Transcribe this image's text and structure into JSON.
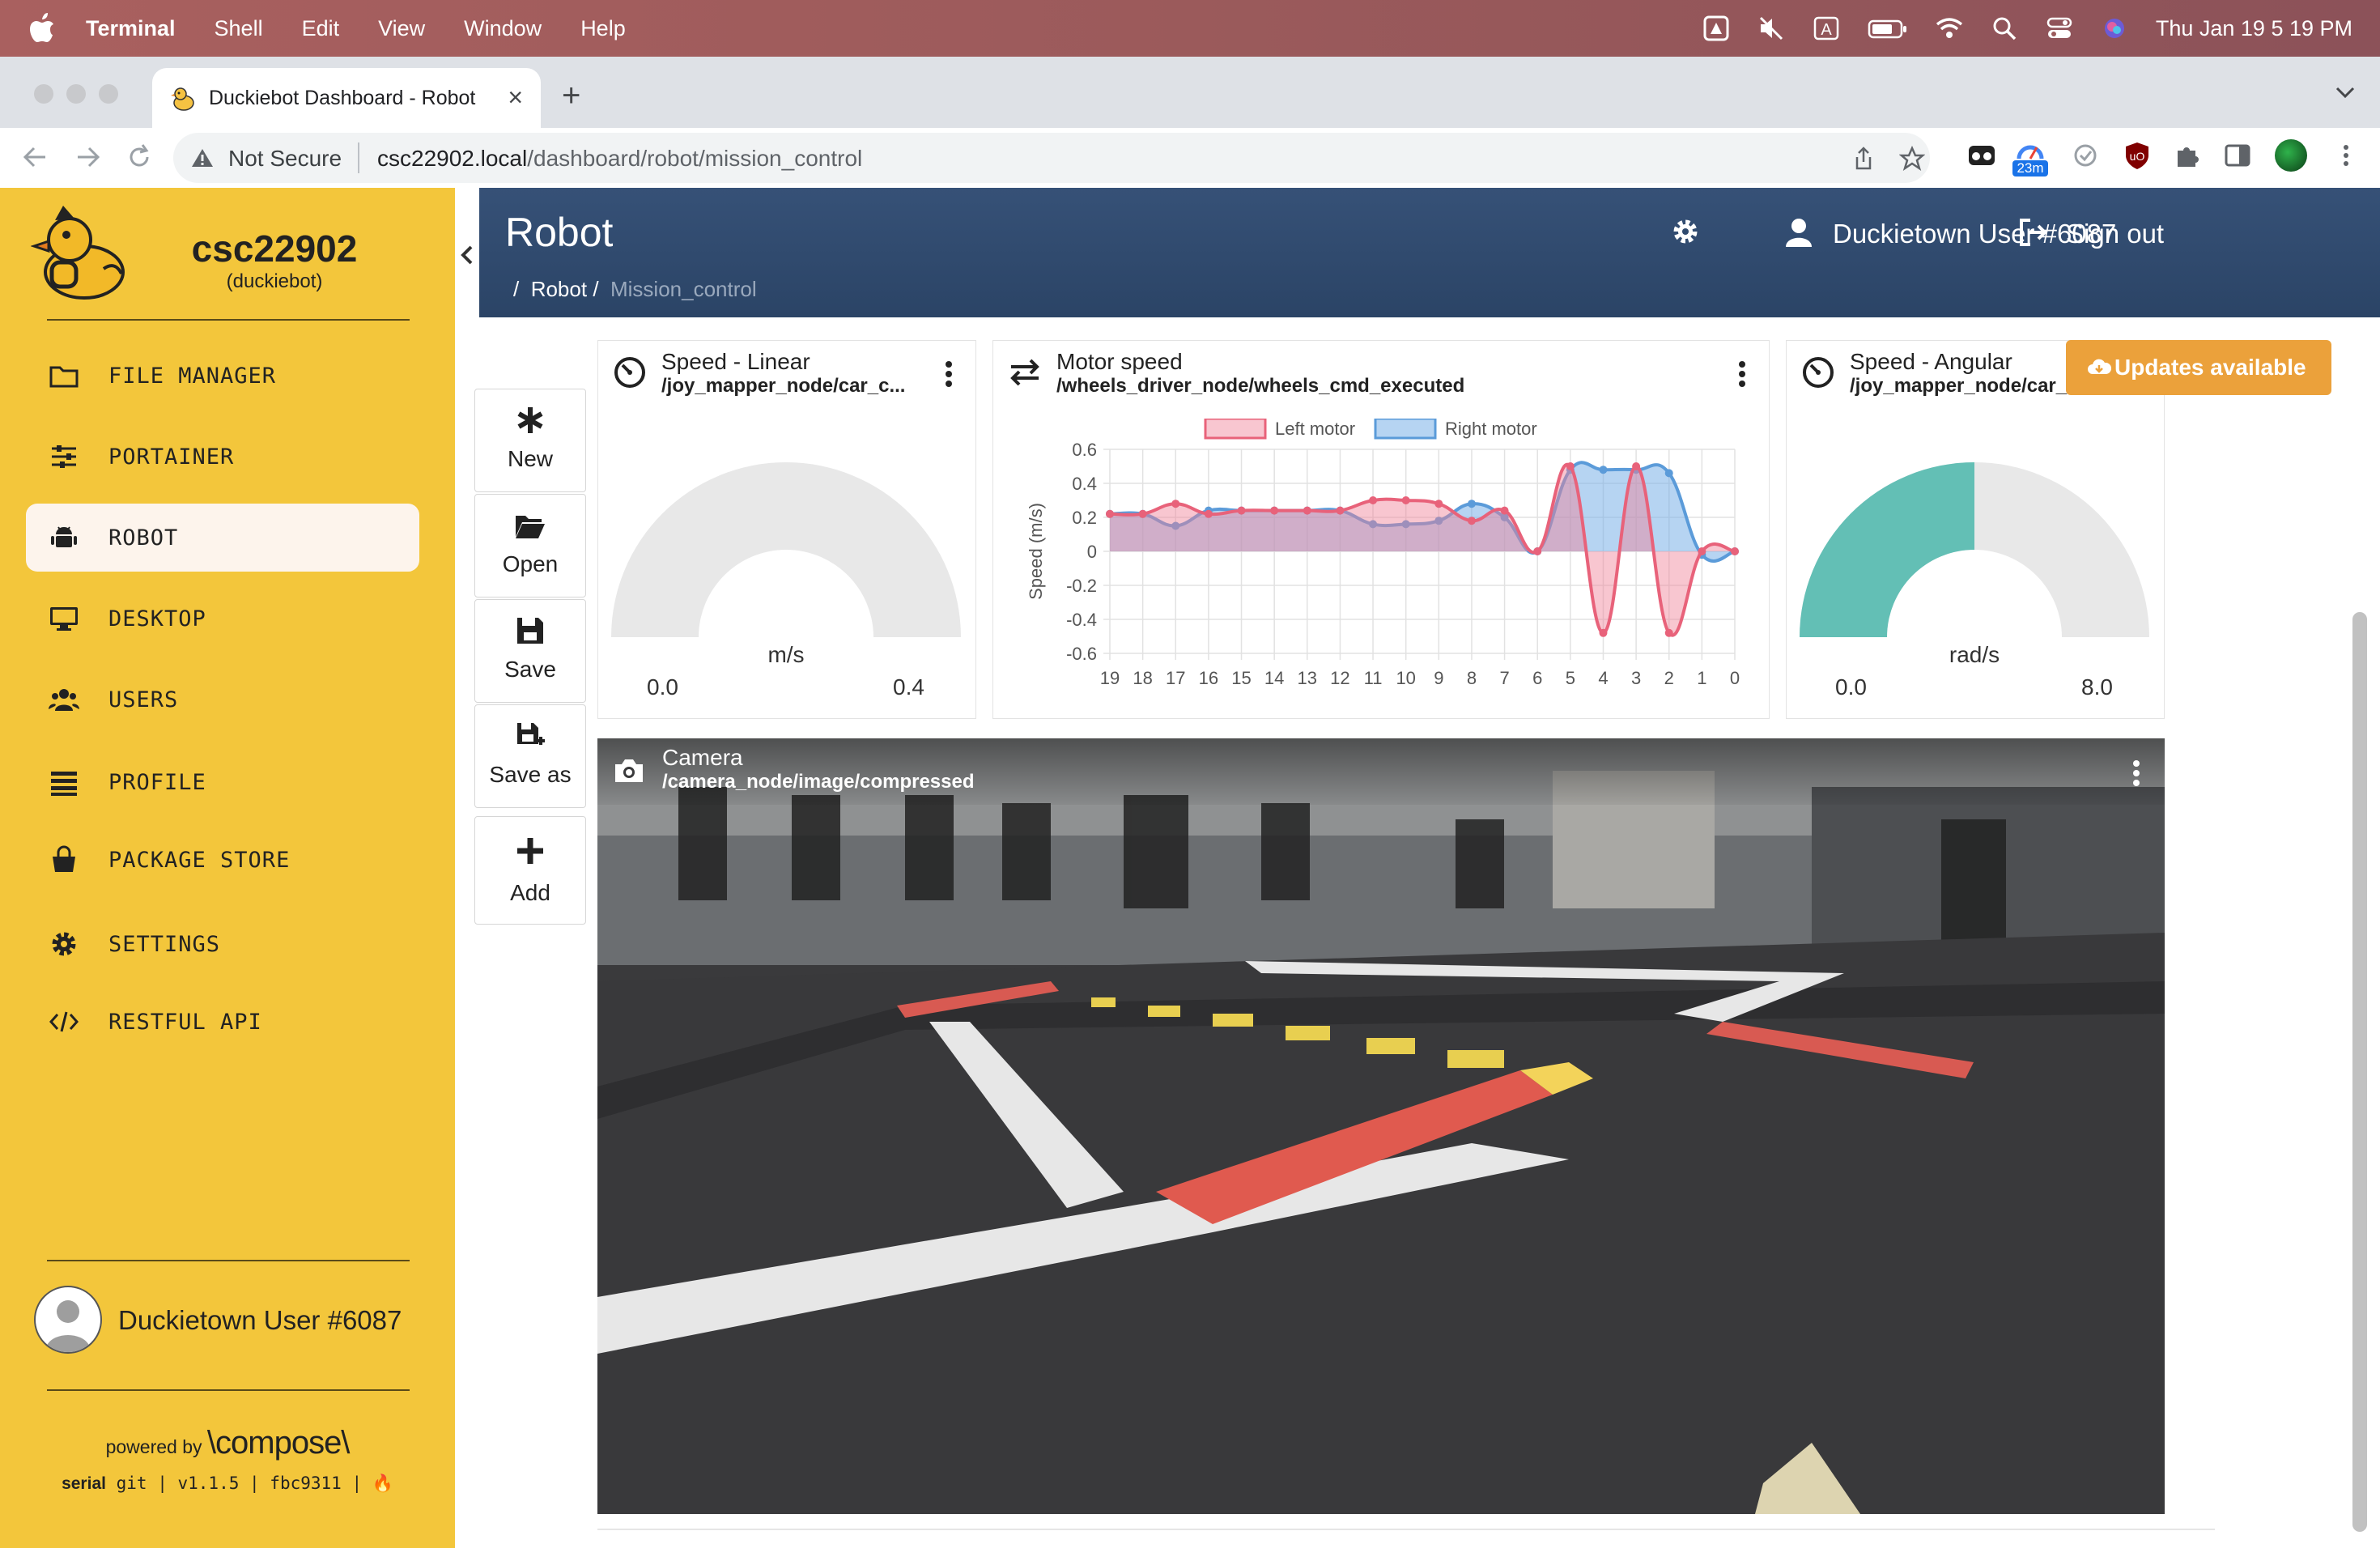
{
  "menubar": {
    "app": "Terminal",
    "items": [
      "Shell",
      "Edit",
      "View",
      "Window",
      "Help"
    ],
    "clock": "Thu Jan 19  5 19 PM"
  },
  "browser": {
    "tab_title": "Duckiebot Dashboard - Robot",
    "security": "Not Secure",
    "url_host": "csc22902.local",
    "url_path": "/dashboard/robot/mission_control",
    "ext_badge": "23m"
  },
  "sidebar": {
    "hostname": "csc22902",
    "robot_type": "(duckiebot)",
    "items": [
      {
        "label": "FILE MANAGER",
        "icon": "folder-icon"
      },
      {
        "label": "PORTAINER",
        "icon": "sliders-icon"
      },
      {
        "label": "ROBOT",
        "icon": "android-icon",
        "active": true
      },
      {
        "label": "DESKTOP",
        "icon": "monitor-icon"
      },
      {
        "label": "USERS",
        "icon": "users-icon"
      },
      {
        "label": "PROFILE",
        "icon": "list-icon"
      },
      {
        "label": "PACKAGE STORE",
        "icon": "shopping-bag-icon"
      },
      {
        "label": "SETTINGS",
        "icon": "gear-icon"
      },
      {
        "label": "RESTFUL API",
        "icon": "code-icon"
      }
    ],
    "user_name": "Duckietown User #6087",
    "powered_by": "powered by",
    "brand": "\\compose\\",
    "footer_serial": "serial",
    "footer_git": "git",
    "footer_version": "v1.1.5",
    "footer_hash": "fbc9311"
  },
  "header": {
    "title": "Robot",
    "breadcrumb_sep": "/",
    "breadcrumb_robot": "Robot",
    "breadcrumb_current": "Mission_control",
    "user_name": "Duckietown User #6087",
    "signout": "Sign out"
  },
  "toolbar": {
    "new": "New",
    "open": "Open",
    "save": "Save",
    "save_as": "Save as",
    "add": "Add"
  },
  "updates_label": "Updates available",
  "widgets": {
    "speed_linear": {
      "title": "Speed - Linear",
      "topic": "/joy_mapper_node/car_c...",
      "unit": "m/s",
      "min": "0.0",
      "max": "0.4",
      "value_fraction": 0
    },
    "motor_speed": {
      "title": "Motor speed",
      "topic": "/wheels_driver_node/wheels_cmd_executed"
    },
    "speed_angular": {
      "title": "Speed - Angular",
      "topic": "/joy_mapper_node/car_c...",
      "unit": "rad/s",
      "min": "0.0",
      "max": "8.0",
      "value_fraction": 0.5,
      "fill_color": "#63bfb5"
    },
    "camera": {
      "title": "Camera",
      "topic": "/camera_node/image/compressed"
    }
  },
  "chart_data": {
    "type": "area",
    "x": [
      19,
      18,
      17,
      16,
      15,
      14,
      13,
      12,
      11,
      10,
      9,
      8,
      7,
      6,
      5,
      4,
      3,
      2,
      1,
      0
    ],
    "xlabel": "",
    "ylabel": "Speed (m/s)",
    "ylim": [
      -0.6,
      0.6
    ],
    "yticks": [
      0.6,
      0.4,
      0.2,
      0,
      -0.2,
      -0.4,
      -0.6
    ],
    "yticklabels": [
      "0.6",
      "0.4",
      "0.2",
      "0",
      "-0.2",
      "-0.4",
      "-0.6"
    ],
    "xticklabels": [
      "19",
      "18",
      "17",
      "16",
      "15",
      "14",
      "13",
      "12",
      "11",
      "10",
      "9",
      "8",
      "7",
      "6",
      "5",
      "4",
      "3",
      "2",
      "1",
      "0"
    ],
    "grid": true,
    "legend": "top",
    "series": [
      {
        "name": "Left motor",
        "color": "#e8627a",
        "fill": "rgba(240,128,150,0.45)",
        "values": [
          0.22,
          0.22,
          0.28,
          0.22,
          0.24,
          0.24,
          0.24,
          0.24,
          0.3,
          0.3,
          0.28,
          0.18,
          0.24,
          0.0,
          0.5,
          -0.48,
          0.5,
          -0.48,
          0.0,
          0.0
        ]
      },
      {
        "name": "Right motor",
        "color": "#5b9bd9",
        "fill": "rgba(110,170,230,0.5)",
        "values": [
          0.22,
          0.22,
          0.15,
          0.24,
          0.24,
          0.24,
          0.24,
          0.24,
          0.16,
          0.16,
          0.18,
          0.28,
          0.2,
          0.0,
          0.48,
          0.48,
          0.48,
          0.46,
          -0.02,
          0.0
        ]
      }
    ]
  }
}
